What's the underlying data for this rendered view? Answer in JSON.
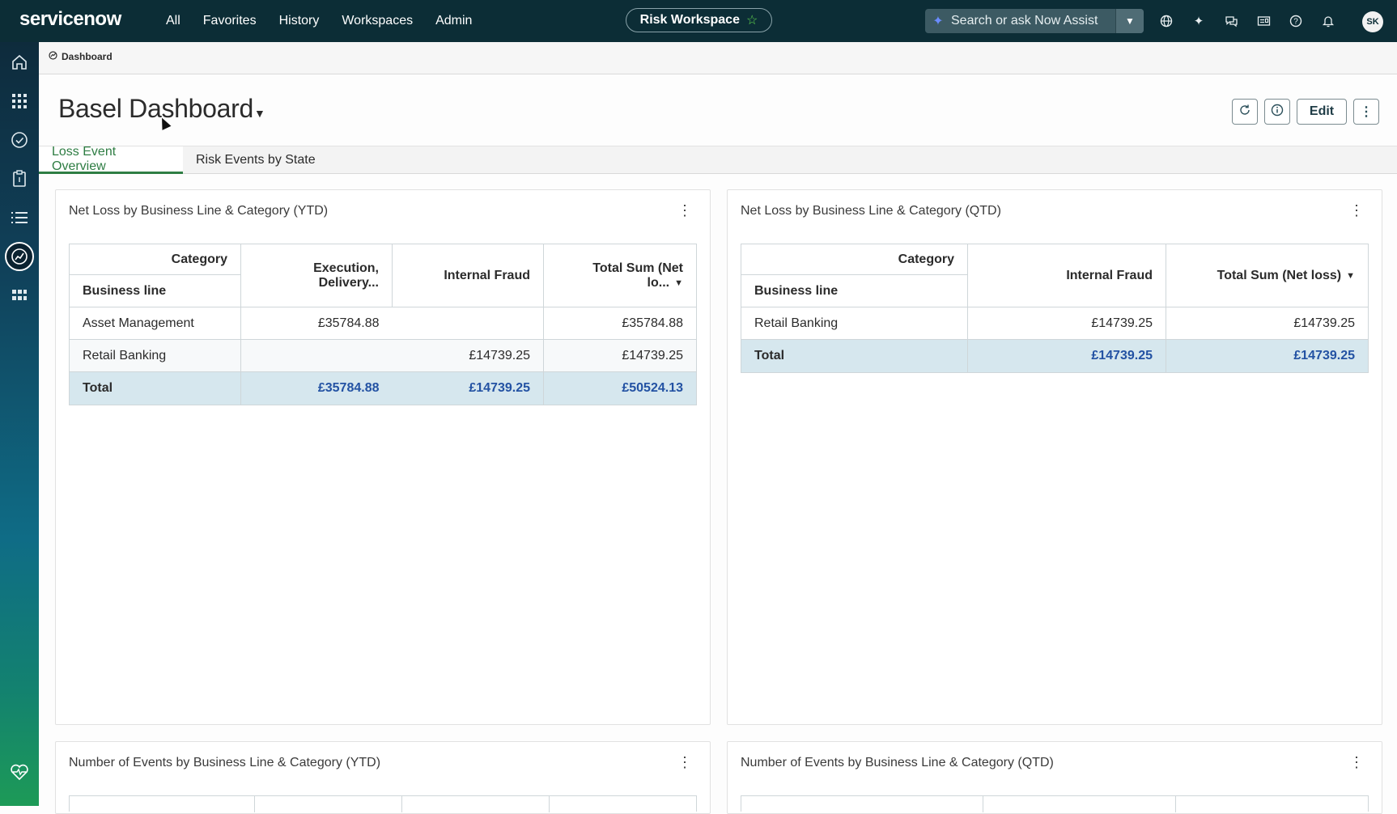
{
  "nav": {
    "logo": "servicenow",
    "links": [
      "All",
      "Favorites",
      "History",
      "Workspaces",
      "Admin"
    ],
    "workspace": "Risk Workspace",
    "search_placeholder": "Search or ask Now Assist",
    "avatar_initials": "SK",
    "icons": [
      "globe-icon",
      "sparkle-icon",
      "chat-icon",
      "inbox-icon",
      "help-icon",
      "bell-icon"
    ]
  },
  "rail": {
    "icons": [
      "home-icon",
      "apps-grid-icon",
      "check-circle-icon",
      "clipboard-icon",
      "list-icon",
      "dashboard-gauge-icon",
      "modules-icon",
      "heart-pulse-icon"
    ]
  },
  "breadcrumb": {
    "label": "Dashboard"
  },
  "header": {
    "title": "Basel Dashboard",
    "edit_label": "Edit"
  },
  "tabs": [
    {
      "label": "Loss Event Overview",
      "active": true
    },
    {
      "label": "Risk Events by State",
      "active": false
    }
  ],
  "widgets": {
    "ytd": {
      "title": "Net Loss by Business Line & Category (YTD)",
      "category_label": "Category",
      "business_line_label": "Business line",
      "columns": [
        "Execution, Delivery...",
        "Internal Fraud",
        "Total Sum (Net lo..."
      ],
      "rows": [
        {
          "label": "Asset Management",
          "c1": "£35784.88",
          "c2": "",
          "total": "£35784.88"
        },
        {
          "label": "Retail Banking",
          "c1": "",
          "c2": "£14739.25",
          "total": "£14739.25"
        }
      ],
      "total_row": {
        "label": "Total",
        "c1": "£35784.88",
        "c2": "£14739.25",
        "total": "£50524.13"
      }
    },
    "qtd": {
      "title": "Net Loss by Business Line & Category (QTD)",
      "category_label": "Category",
      "business_line_label": "Business line",
      "columns": [
        "Internal Fraud",
        "Total Sum (Net loss)"
      ],
      "rows": [
        {
          "label": "Retail Banking",
          "c1": "£14739.25",
          "total": "£14739.25"
        }
      ],
      "total_row": {
        "label": "Total",
        "c1": "£14739.25",
        "total": "£14739.25"
      }
    },
    "events_ytd": {
      "title": "Number of Events by Business Line & Category (YTD)"
    },
    "events_qtd": {
      "title": "Number of Events by Business Line & Category (QTD)"
    }
  }
}
